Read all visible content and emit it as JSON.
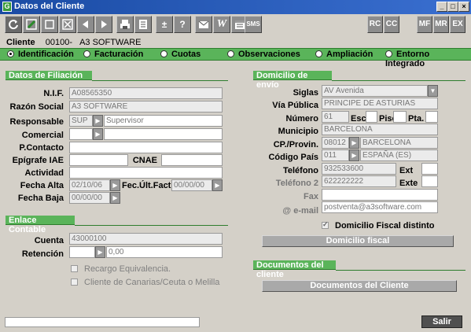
{
  "window": {
    "title": "Datos del Cliente",
    "app_icon_letter": "G",
    "controls": [
      "_",
      "□",
      "×"
    ]
  },
  "toolbar": {
    "left_buttons": [
      "refresh",
      "edit-pen",
      "blank",
      "delete-x",
      "prev-arrow",
      "next-arrow",
      "print",
      "list"
    ],
    "help_labels": [
      "±",
      "?"
    ],
    "right_labels": [
      "W",
      "SMS"
    ],
    "rc": "RC",
    "cc": "CC",
    "mf": "MF",
    "mr": "MR",
    "ex": "EX"
  },
  "client": {
    "label": "Cliente",
    "code": "00100-",
    "name": "A3 SOFTWARE"
  },
  "tabs": [
    {
      "label": "Identificación",
      "selected": true
    },
    {
      "label": "Facturación",
      "selected": false
    },
    {
      "label": "Cuotas",
      "selected": false
    },
    {
      "label": "Observaciones",
      "selected": false
    },
    {
      "label": "Ampliación",
      "selected": false
    },
    {
      "label": "Entorno Integrado",
      "selected": false
    }
  ],
  "filiacion": {
    "title": "Datos de Filiación",
    "nif_label": "N.I.F.",
    "nif": "A08565350",
    "razon_label": "Razón Social",
    "razon": "A3 SOFTWARE",
    "responsable_label": "Responsable",
    "responsable_code": "SUP",
    "responsable_name": "Supervisor",
    "comercial_label": "Comercial",
    "pcontacto_label": "P.Contacto",
    "epigrafe_label": "Epígrafe  IAE",
    "cnae_label": "CNAE",
    "actividad_label": "Actividad",
    "fecha_alta_label": "Fecha Alta",
    "fecha_alta": "02/10/06",
    "fec_ult_label": "Fec.Últ.Fact.",
    "fec_ult": "00/00/00",
    "fecha_baja_label": "Fecha Baja",
    "fecha_baja": "00/00/00"
  },
  "contable": {
    "title": "Enlace Contable",
    "cuenta_label": "Cuenta",
    "cuenta": "43000100",
    "retencion_label": "Retención",
    "retencion": "0,00",
    "recargo_label": "Recargo Equivalencia.",
    "canarias_label": "Cliente de Canarias/Ceuta o Melilla"
  },
  "envio": {
    "title": "Domicilio de envío",
    "siglas_label": "Siglas",
    "siglas": "AV Avenida",
    "via_label": "Vía Pública",
    "via": "PRINCIPE DE ASTURIAS",
    "numero_label": "Número",
    "numero": "61",
    "esc_label": "Esc",
    "piso_label": "Piso",
    "pta_label": "Pta.",
    "municipio_label": "Municipio",
    "municipio": "BARCELONA",
    "cp_label": "CP./Provin.",
    "cp": "08012",
    "provincia": "BARCELONA",
    "pais_label": "Código País",
    "pais_code": "011",
    "pais": "ESPAÑA (ES)",
    "telefono_label": "Teléfono",
    "telefono": "932533600",
    "ext_label": "Ext",
    "telefono2_label": "Teléfono 2",
    "telefono2": "622222222",
    "exte_label": "Exte",
    "fax_label": "Fax",
    "email_label": "@ e-mail",
    "email": "postventa@a3software.com",
    "fiscal_check_label": "Domicilio Fiscal distinto",
    "fiscal_button": "Domicilio fiscal"
  },
  "documentos": {
    "title": "Documentos del cliente",
    "button": "Documentos del Cliente"
  },
  "footer": {
    "status": "",
    "salir": "Salir"
  },
  "colors": {
    "section_green": "#5ab45a",
    "title_blue": "#1a4ba4"
  }
}
